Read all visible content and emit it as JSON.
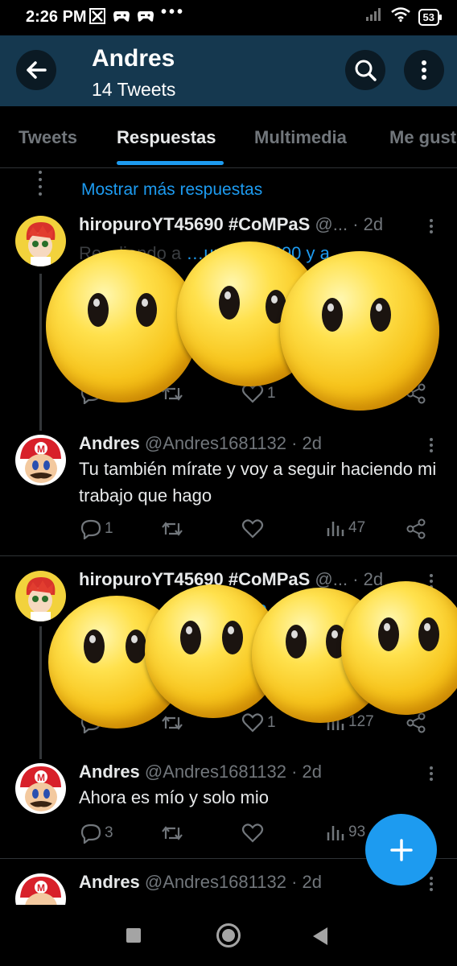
{
  "status_bar": {
    "time": "2:26 PM",
    "battery": "53",
    "notif_icons": [
      "x-icon",
      "gamepad-icon",
      "gamepad-icon"
    ],
    "more": "•••"
  },
  "header": {
    "title": "Andres",
    "subtitle": "14 Tweets"
  },
  "tabs": [
    {
      "label": "Tweets",
      "active": false
    },
    {
      "label": "Respuestas",
      "active": true
    },
    {
      "label": "Multimedia",
      "active": false
    },
    {
      "label": "Me gust",
      "active": false
    }
  ],
  "thread": {
    "show_more": "Mostrar más respuestas"
  },
  "tweets": [
    {
      "name": "hiropuroYT45690 #CoMPaS",
      "meta": " @... · 2d",
      "text_prefix": "Re",
      "text_mid": "…liendo a",
      "mention": "…uroYT45690 y a",
      "reply_count": "",
      "like_count": "1",
      "view_count": ""
    },
    {
      "name": "Andres",
      "meta": " @Andres1681132 · 2d",
      "text": "Tu también mírate y voy a seguir haciendo mi trabajo que hago",
      "reply_count": "1",
      "like_count": "",
      "view_count": "47"
    },
    {
      "name": "hiropuroYT45690 #CoMPaS",
      "meta": " @... · 2d",
      "text_prefix": "",
      "mention": "dre",
      "reply_count": "2",
      "like_count": "1",
      "view_count": "127"
    },
    {
      "name": "Andres",
      "meta": " @Andres1681132 · 2d",
      "text": "Ahora es mío y solo mio",
      "reply_count": "3",
      "like_count": "",
      "view_count": "93"
    },
    {
      "name": "Andres",
      "meta": " @Andres1681132 · 2d",
      "text": ""
    }
  ],
  "colors": {
    "accent": "#1d9bf0",
    "header_bg": "#15384f",
    "muted": "#71767b",
    "text": "#e7e9ea",
    "background": "#000000"
  },
  "overlay": {
    "icon": "face-without-mouth-emoji"
  }
}
